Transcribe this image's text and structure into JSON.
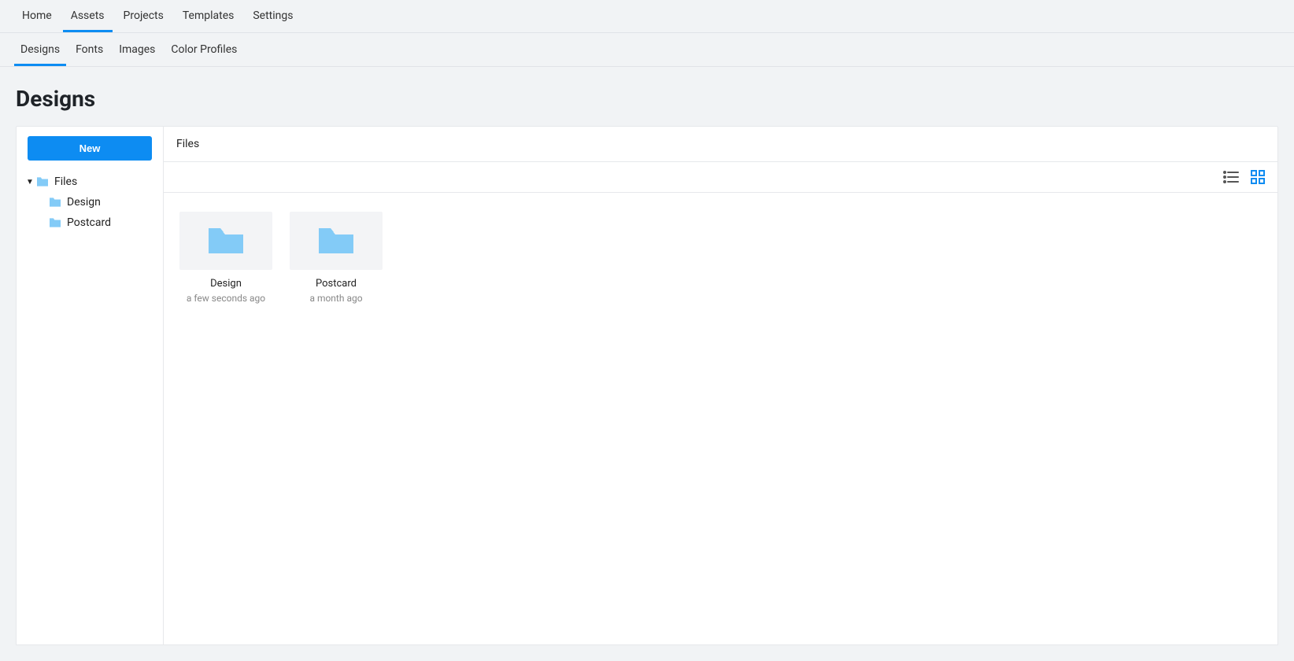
{
  "colors": {
    "accent": "#0d8cf2",
    "folder": "#83cbf7"
  },
  "topnav": {
    "items": [
      {
        "label": "Home",
        "active": false
      },
      {
        "label": "Assets",
        "active": true
      },
      {
        "label": "Projects",
        "active": false
      },
      {
        "label": "Templates",
        "active": false
      },
      {
        "label": "Settings",
        "active": false
      }
    ]
  },
  "subnav": {
    "items": [
      {
        "label": "Designs",
        "active": true
      },
      {
        "label": "Fonts",
        "active": false
      },
      {
        "label": "Images",
        "active": false
      },
      {
        "label": "Color Profiles",
        "active": false
      }
    ]
  },
  "page": {
    "title": "Designs"
  },
  "sidebar": {
    "new_label": "New",
    "tree": {
      "root": {
        "label": "Files",
        "expanded": true
      },
      "children": [
        {
          "label": "Design"
        },
        {
          "label": "Postcard"
        }
      ]
    }
  },
  "main": {
    "breadcrumb": "Files",
    "view_mode": "grid",
    "items": [
      {
        "name": "Design",
        "time": "a few seconds ago"
      },
      {
        "name": "Postcard",
        "time": "a month ago"
      }
    ]
  }
}
